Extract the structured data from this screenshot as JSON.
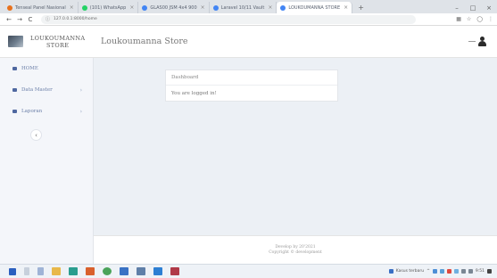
{
  "browser": {
    "tabs": [
      {
        "label": "Tenseal Panel Nasional",
        "color": "#e8711c"
      },
      {
        "label": "(101) WhatsApp",
        "color": "#25d366"
      },
      {
        "label": "GLAS00 JSM 4x4 900",
        "color": "#4285f4"
      },
      {
        "label": "Laravel 10/11 Vault",
        "color": "#4285f4"
      },
      {
        "label": "LOUKOUMANNA STORE",
        "color": "#4285f4",
        "active": true
      }
    ],
    "new_tab": "+",
    "window_controls": [
      "–",
      "□",
      "×"
    ],
    "url": "127.0.0.1:8000/home",
    "nav": [
      "←",
      "→",
      "C"
    ]
  },
  "header": {
    "logo_line1": "LOUKOUMANNA",
    "logo_line2": "STORE",
    "store_name": "Loukoumanna Store"
  },
  "sidebar": {
    "items": [
      {
        "label": "HOME",
        "chev": ""
      },
      {
        "label": "Data Master",
        "chev": "›"
      },
      {
        "label": "Laporan",
        "chev": "›"
      }
    ],
    "collapse_icon": "‹"
  },
  "card": {
    "title": "Dashboard",
    "message": "You are logged in!"
  },
  "footer": {
    "line1": "Develop by 20'2021",
    "line2": "Copyright © development"
  },
  "taskbar": {
    "tray_text": "Kasus terbaru",
    "clock": "9:51"
  }
}
